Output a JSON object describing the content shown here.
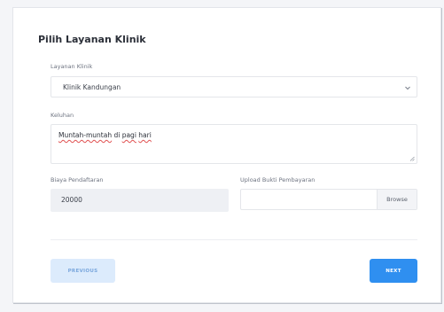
{
  "form": {
    "title": "Pilih Layanan Klinik",
    "layanan": {
      "label": "Layanan Klinik",
      "selected": "Klinik Kandungan"
    },
    "keluhan": {
      "label": "Keluhan",
      "value_part1": "Muntah-muntah",
      "value_part2": " di ",
      "value_part3": "pagi",
      "value_part4": " ",
      "value_part5": "hari"
    },
    "biaya": {
      "label": "Biaya Pendaftaran",
      "value": "20000"
    },
    "upload": {
      "label": "Upload Bukti Pembayaran",
      "browse_label": "Browse"
    }
  },
  "buttons": {
    "previous_label": "PREVIOUS",
    "next_label": "NEXT"
  },
  "colors": {
    "primary": "#2f8ff0",
    "primary_light": "#dcebfc",
    "spellcheck": "#e05050"
  },
  "icons": {
    "select_caret": "chevron-down-icon",
    "resize": "resize-grip-icon"
  }
}
